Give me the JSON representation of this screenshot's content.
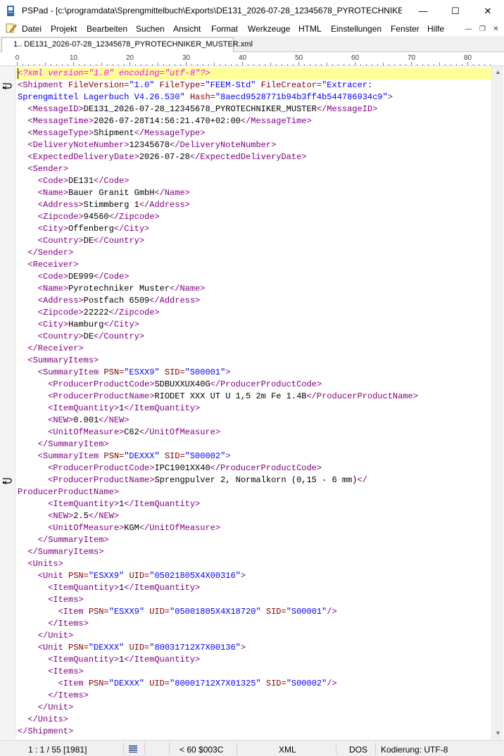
{
  "window": {
    "title": "PSPad - [c:\\programdata\\Sprengmittelbuch\\Exports\\DE131_2026-07-28_12345678_PYROTECHNIKER_...",
    "minimize": "—",
    "maximize": "☐",
    "close": "✕"
  },
  "menu": {
    "items": [
      "Datei",
      "Projekt",
      "Bearbeiten",
      "Suchen",
      "Ansicht",
      "Format",
      "Werkzeuge",
      "HTML",
      "Einstellungen",
      "Fenster",
      "Hilfe"
    ],
    "mdi_minimize": "—",
    "mdi_restore": "❐",
    "mdi_close": "✕"
  },
  "tab": {
    "label": "1.. DE131_2026-07-28_12345678_PYROTECHNIKER_MUSTER.xml"
  },
  "ruler": {
    "labels": [
      "0",
      "10",
      "20",
      "30",
      "40",
      "50",
      "60",
      "70",
      "80"
    ]
  },
  "editor": {
    "lines": [
      [
        {
          "c": "pi",
          "t": "<?xml version=\"1.0\" encoding=\"utf-8\"?>"
        }
      ],
      [
        {
          "c": "t",
          "t": "<Shipment "
        },
        {
          "c": "a",
          "t": "FileVersion="
        },
        {
          "c": "v",
          "t": "\"1.0\" "
        },
        {
          "c": "a",
          "t": "FileType="
        },
        {
          "c": "v",
          "t": "\"FEEM-Std\" "
        },
        {
          "c": "a",
          "t": "FileCreator="
        },
        {
          "c": "v",
          "t": "\"Extracer:"
        }
      ],
      [
        {
          "c": "v",
          "t": "Sprengmittel Lagerbuch V4.26.530\" "
        },
        {
          "c": "a",
          "t": "Hash="
        },
        {
          "c": "v",
          "t": "\"8aecd9528771b94b3ff4b544786934c9\""
        },
        {
          "c": "t",
          "t": ">"
        }
      ],
      [
        {
          "c": "t",
          "t": "  <MessageID>"
        },
        {
          "c": "x",
          "t": "DE131_2026-07-28_12345678_PYROTECHNIKER_MUSTER"
        },
        {
          "c": "t",
          "t": "</MessageID>"
        }
      ],
      [
        {
          "c": "t",
          "t": "  <MessageTime>"
        },
        {
          "c": "x",
          "t": "2026-07-28T14:56:21.470+02:00"
        },
        {
          "c": "t",
          "t": "</MessageTime>"
        }
      ],
      [
        {
          "c": "t",
          "t": "  <MessageType>"
        },
        {
          "c": "x",
          "t": "Shipment"
        },
        {
          "c": "t",
          "t": "</MessageType>"
        }
      ],
      [
        {
          "c": "t",
          "t": "  <DeliveryNoteNumber>"
        },
        {
          "c": "x",
          "t": "12345678"
        },
        {
          "c": "t",
          "t": "</DeliveryNoteNumber>"
        }
      ],
      [
        {
          "c": "t",
          "t": "  <ExpectedDeliveryDate>"
        },
        {
          "c": "x",
          "t": "2026-07-28"
        },
        {
          "c": "t",
          "t": "</ExpectedDeliveryDate>"
        }
      ],
      [
        {
          "c": "t",
          "t": "  <Sender>"
        }
      ],
      [
        {
          "c": "t",
          "t": "    <Code>"
        },
        {
          "c": "x",
          "t": "DE131"
        },
        {
          "c": "t",
          "t": "</Code>"
        }
      ],
      [
        {
          "c": "t",
          "t": "    <Name>"
        },
        {
          "c": "x",
          "t": "Bauer Granit GmbH"
        },
        {
          "c": "t",
          "t": "</Name>"
        }
      ],
      [
        {
          "c": "t",
          "t": "    <Address>"
        },
        {
          "c": "x",
          "t": "Stimmberg 1"
        },
        {
          "c": "t",
          "t": "</Address>"
        }
      ],
      [
        {
          "c": "t",
          "t": "    <Zipcode>"
        },
        {
          "c": "x",
          "t": "94560"
        },
        {
          "c": "t",
          "t": "</Zipcode>"
        }
      ],
      [
        {
          "c": "t",
          "t": "    <City>"
        },
        {
          "c": "x",
          "t": "Offenberg"
        },
        {
          "c": "t",
          "t": "</City>"
        }
      ],
      [
        {
          "c": "t",
          "t": "    <Country>"
        },
        {
          "c": "x",
          "t": "DE"
        },
        {
          "c": "t",
          "t": "</Country>"
        }
      ],
      [
        {
          "c": "t",
          "t": "  </Sender>"
        }
      ],
      [
        {
          "c": "t",
          "t": "  <Receiver>"
        }
      ],
      [
        {
          "c": "t",
          "t": "    <Code>"
        },
        {
          "c": "x",
          "t": "DE999"
        },
        {
          "c": "t",
          "t": "</Code>"
        }
      ],
      [
        {
          "c": "t",
          "t": "    <Name>"
        },
        {
          "c": "x",
          "t": "Pyrotechniker Muster"
        },
        {
          "c": "t",
          "t": "</Name>"
        }
      ],
      [
        {
          "c": "t",
          "t": "    <Address>"
        },
        {
          "c": "x",
          "t": "Postfach 6509"
        },
        {
          "c": "t",
          "t": "</Address>"
        }
      ],
      [
        {
          "c": "t",
          "t": "    <Zipcode>"
        },
        {
          "c": "x",
          "t": "22222"
        },
        {
          "c": "t",
          "t": "</Zipcode>"
        }
      ],
      [
        {
          "c": "t",
          "t": "    <City>"
        },
        {
          "c": "x",
          "t": "Hamburg"
        },
        {
          "c": "t",
          "t": "</City>"
        }
      ],
      [
        {
          "c": "t",
          "t": "    <Country>"
        },
        {
          "c": "x",
          "t": "DE"
        },
        {
          "c": "t",
          "t": "</Country>"
        }
      ],
      [
        {
          "c": "t",
          "t": "  </Receiver>"
        }
      ],
      [
        {
          "c": "t",
          "t": "  <SummaryItems>"
        }
      ],
      [
        {
          "c": "t",
          "t": "    <SummaryItem "
        },
        {
          "c": "a",
          "t": "PSN="
        },
        {
          "c": "v",
          "t": "\"ESXX9\" "
        },
        {
          "c": "a",
          "t": "SID="
        },
        {
          "c": "v",
          "t": "\"S00001\""
        },
        {
          "c": "t",
          "t": ">"
        }
      ],
      [
        {
          "c": "t",
          "t": "      <ProducerProductCode>"
        },
        {
          "c": "x",
          "t": "SDBUXXUX40G"
        },
        {
          "c": "t",
          "t": "</ProducerProductCode>"
        }
      ],
      [
        {
          "c": "t",
          "t": "      <ProducerProductName>"
        },
        {
          "c": "x",
          "t": "RIODET XXX UT U 1,5 2m Fe 1.4B"
        },
        {
          "c": "t",
          "t": "</ProducerProductName>"
        }
      ],
      [
        {
          "c": "t",
          "t": "      <ItemQuantity>"
        },
        {
          "c": "x",
          "t": "1"
        },
        {
          "c": "t",
          "t": "</ItemQuantity>"
        }
      ],
      [
        {
          "c": "t",
          "t": "      <NEW>"
        },
        {
          "c": "x",
          "t": "0.001"
        },
        {
          "c": "t",
          "t": "</NEW>"
        }
      ],
      [
        {
          "c": "t",
          "t": "      <UnitOfMeasure>"
        },
        {
          "c": "x",
          "t": "C62"
        },
        {
          "c": "t",
          "t": "</UnitOfMeasure>"
        }
      ],
      [
        {
          "c": "t",
          "t": "    </SummaryItem>"
        }
      ],
      [
        {
          "c": "t",
          "t": "    <SummaryItem "
        },
        {
          "c": "a",
          "t": "PSN="
        },
        {
          "c": "v",
          "t": "\"DEXXX\" "
        },
        {
          "c": "a",
          "t": "SID="
        },
        {
          "c": "v",
          "t": "\"S00002\""
        },
        {
          "c": "t",
          "t": ">"
        }
      ],
      [
        {
          "c": "t",
          "t": "      <ProducerProductCode>"
        },
        {
          "c": "x",
          "t": "IPC1901XX40"
        },
        {
          "c": "t",
          "t": "</ProducerProductCode>"
        }
      ],
      [
        {
          "c": "t",
          "t": "      <ProducerProductName>"
        },
        {
          "c": "x",
          "t": "Sprengpulver 2, Normalkorn (0,15 - 6 mm)"
        },
        {
          "c": "t",
          "t": "</"
        }
      ],
      [
        {
          "c": "t",
          "t": "ProducerProductName>"
        }
      ],
      [
        {
          "c": "t",
          "t": "      <ItemQuantity>"
        },
        {
          "c": "x",
          "t": "1"
        },
        {
          "c": "t",
          "t": "</ItemQuantity>"
        }
      ],
      [
        {
          "c": "t",
          "t": "      <NEW>"
        },
        {
          "c": "x",
          "t": "2.5"
        },
        {
          "c": "t",
          "t": "</NEW>"
        }
      ],
      [
        {
          "c": "t",
          "t": "      <UnitOfMeasure>"
        },
        {
          "c": "x",
          "t": "KGM"
        },
        {
          "c": "t",
          "t": "</UnitOfMeasure>"
        }
      ],
      [
        {
          "c": "t",
          "t": "    </SummaryItem>"
        }
      ],
      [
        {
          "c": "t",
          "t": "  </SummaryItems>"
        }
      ],
      [
        {
          "c": "t",
          "t": "  <Units>"
        }
      ],
      [
        {
          "c": "t",
          "t": "    <Unit "
        },
        {
          "c": "a",
          "t": "PSN="
        },
        {
          "c": "v",
          "t": "\"ESXX9\" "
        },
        {
          "c": "a",
          "t": "UID="
        },
        {
          "c": "v",
          "t": "\"05021805X4X00316\""
        },
        {
          "c": "t",
          "t": ">"
        }
      ],
      [
        {
          "c": "t",
          "t": "      <ItemQuantity>"
        },
        {
          "c": "x",
          "t": "1"
        },
        {
          "c": "t",
          "t": "</ItemQuantity>"
        }
      ],
      [
        {
          "c": "t",
          "t": "      <Items>"
        }
      ],
      [
        {
          "c": "t",
          "t": "        <Item "
        },
        {
          "c": "a",
          "t": "PSN="
        },
        {
          "c": "v",
          "t": "\"ESXX9\" "
        },
        {
          "c": "a",
          "t": "UID="
        },
        {
          "c": "v",
          "t": "\"05001805X4X18720\" "
        },
        {
          "c": "a",
          "t": "SID="
        },
        {
          "c": "v",
          "t": "\"S00001\""
        },
        {
          "c": "t",
          "t": "/>"
        }
      ],
      [
        {
          "c": "t",
          "t": "      </Items>"
        }
      ],
      [
        {
          "c": "t",
          "t": "    </Unit>"
        }
      ],
      [
        {
          "c": "t",
          "t": "    <Unit "
        },
        {
          "c": "a",
          "t": "PSN="
        },
        {
          "c": "v",
          "t": "\"DEXXX\" "
        },
        {
          "c": "a",
          "t": "UID="
        },
        {
          "c": "v",
          "t": "\"80031712X7X00136\""
        },
        {
          "c": "t",
          "t": ">"
        }
      ],
      [
        {
          "c": "t",
          "t": "      <ItemQuantity>"
        },
        {
          "c": "x",
          "t": "1"
        },
        {
          "c": "t",
          "t": "</ItemQuantity>"
        }
      ],
      [
        {
          "c": "t",
          "t": "      <Items>"
        }
      ],
      [
        {
          "c": "t",
          "t": "        <Item "
        },
        {
          "c": "a",
          "t": "PSN="
        },
        {
          "c": "v",
          "t": "\"DEXXX\" "
        },
        {
          "c": "a",
          "t": "UID="
        },
        {
          "c": "v",
          "t": "\"80001712X7X01325\" "
        },
        {
          "c": "a",
          "t": "SID="
        },
        {
          "c": "v",
          "t": "\"S00002\""
        },
        {
          "c": "t",
          "t": "/>"
        }
      ],
      [
        {
          "c": "t",
          "t": "      </Items>"
        }
      ],
      [
        {
          "c": "t",
          "t": "    </Unit>"
        }
      ],
      [
        {
          "c": "t",
          "t": "  </Units>"
        }
      ],
      [
        {
          "c": "t",
          "t": "</Shipment>"
        }
      ]
    ],
    "wrapped_line_indices": [
      1,
      34
    ],
    "current_line_index": 0
  },
  "scrollbar": {
    "up": "▲",
    "down": "▼"
  },
  "status": {
    "position": "1 : 1 / 55  [1981]",
    "char_info": "<   60  $003C",
    "syntax": "XML",
    "line_ending": "DOS",
    "encoding": "Kodierung: UTF-8"
  },
  "colors": {
    "tag": "#800080",
    "attribute": "#800000",
    "value": "#0000ff",
    "processing_instruction": "#ff00ff",
    "current_line": "#ffff99"
  }
}
